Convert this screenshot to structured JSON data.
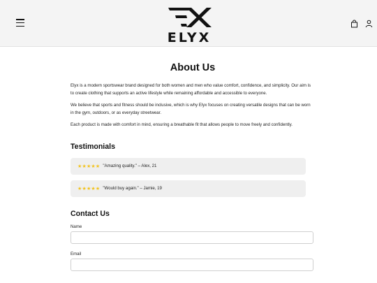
{
  "header": {
    "brand": "ELYX",
    "colors": {
      "background": "#f4f4f4",
      "text": "#111111"
    },
    "icons": {
      "menu": "hamburger-menu-icon",
      "bag": "shopping-bag-icon",
      "account": "user-icon"
    }
  },
  "about": {
    "title": "About Us",
    "paragraphs": [
      "Elyx is a modern sportswear brand designed for both women and men who value comfort, confidence, and simplicity. Our aim is to create clothing that supports an active lifestyle while remaining affordable and accessible to everyone.",
      "We believe that sports and fitness should be inclusive, which is why Elyx focuses on creating versatile designs that can be worn in the gym, outdoors, or as everyday streetwear.",
      "Each product is made with comfort in mind, ensuring a breathable fit that allows people to move freely and confidently."
    ]
  },
  "testimonials": {
    "title": "Testimonials",
    "star_color": "#f2c21b",
    "items": [
      {
        "stars": "★★★★★",
        "rating": 5,
        "text": "\"Amazing quality.\" – Alex, 21"
      },
      {
        "stars": "★★★★★",
        "rating": 5,
        "text": "\"Would buy again.\" – Jamie, 19"
      }
    ]
  },
  "contact": {
    "title": "Contact Us",
    "fields": [
      {
        "label": "Name",
        "value": ""
      },
      {
        "label": "Email",
        "value": ""
      }
    ]
  }
}
